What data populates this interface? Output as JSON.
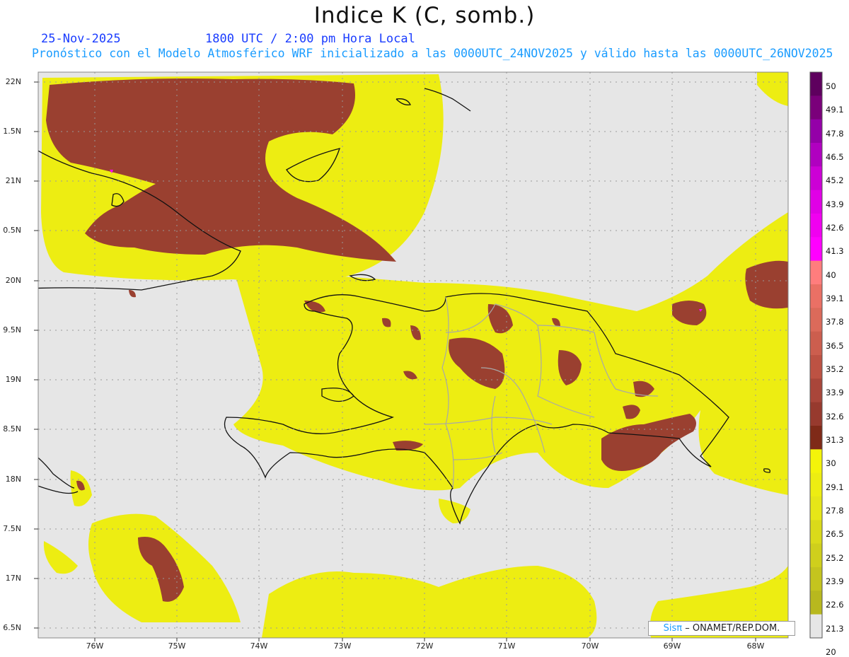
{
  "header": {
    "title": "Indice K (C, somb.)",
    "date": "25-Nov-2025",
    "time": "1800 UTC / 2:00 pm Hora Local",
    "description": "Pronóstico con el Modelo Atmosférico WRF inicializado a las 0000UTC_24NOV2025 y válido hasta las  0000UTC_26NOV2025"
  },
  "axes": {
    "lat_labels": [
      "22N",
      "1.5N",
      "21N",
      "0.5N",
      "20N",
      "9.5N",
      "19N",
      "8.5N",
      "18N",
      "7.5N",
      "17N",
      "6.5N"
    ],
    "lon_labels": [
      "76W",
      "75W",
      "74W",
      "73W",
      "72W",
      "71W",
      "70W",
      "69W",
      "68W"
    ]
  },
  "colorbar": {
    "labels": [
      "50",
      "49.1",
      "47.8",
      "46.5",
      "45.2",
      "43.9",
      "42.6",
      "41.3",
      "40",
      "39.1",
      "37.8",
      "36.5",
      "35.2",
      "33.9",
      "32.6",
      "31.3",
      "30",
      "29.1",
      "27.8",
      "26.5",
      "25.2",
      "23.9",
      "22.6",
      "21.3",
      "20"
    ],
    "colors": [
      "#5e005e",
      "#7a007a",
      "#9400a8",
      "#b000c0",
      "#cc00d6",
      "#e000e6",
      "#f000f0",
      "#ff00ff",
      "#ff7d7d",
      "#ea7065",
      "#db6a5a",
      "#cc5e4e",
      "#bd5243",
      "#a9463a",
      "#973a2e",
      "#7f2a18",
      "#f4f40a",
      "#eded12",
      "#e6e618",
      "#dada1a",
      "#cfcf1c",
      "#c4c41e",
      "#b8b81e",
      "#e6e6e6"
    ]
  },
  "credit": {
    "logo": "Sisπ",
    "text": "– ONAMET/REP.DOM."
  },
  "colors": {
    "background": "#e6e6e6",
    "low_k": "#eded12",
    "high_k": "#9a4030",
    "coast": "#111111",
    "provinces": "#a8a8a8"
  }
}
